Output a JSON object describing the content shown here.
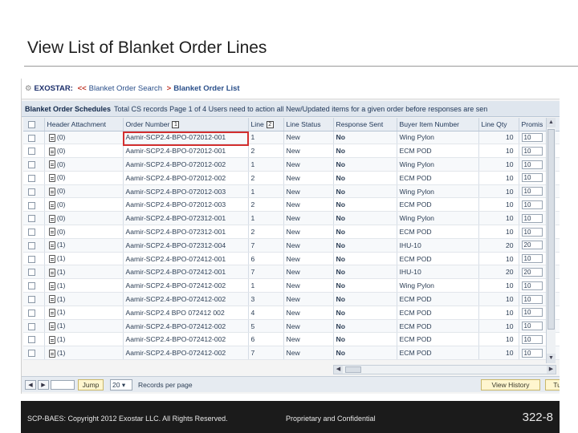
{
  "slide": {
    "title": "View List of Blanket Order Lines"
  },
  "breadcrumb": {
    "brand": "EXOSTAR:",
    "separator": "<<",
    "link": "Blanket Order Search",
    "arrow": ">",
    "current": "Blanket Order List"
  },
  "schedule_bar": {
    "heading": "Blanket Order Schedules",
    "info": "Total CS records Page 1 of 4 Users need to action all New/Updated items for a given order before responses are sen"
  },
  "table": {
    "columns": {
      "header_attachment": "Header Attachment",
      "order_number": "Order Number",
      "order_badge": "1",
      "line": "Line",
      "line_badge": "2",
      "line_status": "Line Status",
      "response_sent": "Response Sent",
      "buyer_item_number": "Buyer Item Number",
      "line_qty": "Line Qty",
      "promise": "Promis"
    },
    "rows": [
      {
        "attach": "(0)",
        "order": "Aamir-SCP2.4-BPO-072012-001",
        "line": "1",
        "status": "New",
        "sent": "No",
        "item": "Wing Pylon",
        "qty": "10",
        "promise": "10"
      },
      {
        "attach": "(0)",
        "order": "Aamir-SCP2.4-BPO-072012-001",
        "line": "2",
        "status": "New",
        "sent": "No",
        "item": "ECM POD",
        "qty": "10",
        "promise": "10"
      },
      {
        "attach": "(0)",
        "order": "Aamir-SCP2.4-BPO-072012-002",
        "line": "1",
        "status": "New",
        "sent": "No",
        "item": "Wing Pylon",
        "qty": "10",
        "promise": "10"
      },
      {
        "attach": "(0)",
        "order": "Aamir-SCP2.4-BPO-072012-002",
        "line": "2",
        "status": "New",
        "sent": "No",
        "item": "ECM POD",
        "qty": "10",
        "promise": "10"
      },
      {
        "attach": "(0)",
        "order": "Aamir-SCP2.4-BPO-072012-003",
        "line": "1",
        "status": "New",
        "sent": "No",
        "item": "Wing Pylon",
        "qty": "10",
        "promise": "10"
      },
      {
        "attach": "(0)",
        "order": "Aamir-SCP2.4-BPO-072012-003",
        "line": "2",
        "status": "New",
        "sent": "No",
        "item": "ECM POD",
        "qty": "10",
        "promise": "10"
      },
      {
        "attach": "(0)",
        "order": "Aamir-SCP2.4-BPO-072312-001",
        "line": "1",
        "status": "New",
        "sent": "No",
        "item": "Wing Pylon",
        "qty": "10",
        "promise": "10"
      },
      {
        "attach": "(0)",
        "order": "Aamir-SCP2.4-BPO-072312-001",
        "line": "2",
        "status": "New",
        "sent": "No",
        "item": "ECM POD",
        "qty": "10",
        "promise": "10"
      },
      {
        "attach": "(1)",
        "order": "Aamir-SCP2.4-BPO-072312-004",
        "line": "7",
        "status": "New",
        "sent": "No",
        "item": "IHU-10",
        "qty": "20",
        "promise": "20"
      },
      {
        "attach": "(1)",
        "order": "Aamir-SCP2.4-BPO-072412-001",
        "line": "6",
        "status": "New",
        "sent": "No",
        "item": "ECM POD",
        "qty": "10",
        "promise": "10"
      },
      {
        "attach": "(1)",
        "order": "Aamir-SCP2.4-BPO-072412-001",
        "line": "7",
        "status": "New",
        "sent": "No",
        "item": "IHU-10",
        "qty": "20",
        "promise": "20"
      },
      {
        "attach": "(1)",
        "order": "Aamir-SCP2.4-BPO-072412-002",
        "line": "1",
        "status": "New",
        "sent": "No",
        "item": "Wing Pylon",
        "qty": "10",
        "promise": "10"
      },
      {
        "attach": "(1)",
        "order": "Aamir-SCP2.4-BPO-072412-002",
        "line": "3",
        "status": "New",
        "sent": "No",
        "item": "ECM POD",
        "qty": "10",
        "promise": "10"
      },
      {
        "attach": "(1)",
        "order": "Aamir-SCP2.4 BPO 072412 002",
        "line": "4",
        "status": "New",
        "sent": "No",
        "item": "ECM POD",
        "qty": "10",
        "promise": "10"
      },
      {
        "attach": "(1)",
        "order": "Aamir-SCP2.4-BPO-072412-002",
        "line": "5",
        "status": "New",
        "sent": "No",
        "item": "ECM POD",
        "qty": "10",
        "promise": "10"
      },
      {
        "attach": "(1)",
        "order": "Aamir-SCP2.4-BPO-072412-002",
        "line": "6",
        "status": "New",
        "sent": "No",
        "item": "ECM POD",
        "qty": "10",
        "promise": "10"
      },
      {
        "attach": "(1)",
        "order": "Aamir-SCP2.4-BPO-072412-002",
        "line": "7",
        "status": "New",
        "sent": "No",
        "item": "ECM POD",
        "qty": "10",
        "promise": "10"
      }
    ]
  },
  "pager": {
    "jump_label": "Jump",
    "per_page_value": "20",
    "per_page_label": "Records per page",
    "view_history_label": "View History",
    "extra_button_label": "Tu"
  },
  "footer": {
    "copyright": "SCP-BAES: Copyright 2012 Exostar LLC. All Rights Reserved.",
    "confidential": "Proprietary and Confidential",
    "page_number": "322-8"
  },
  "colors": {
    "highlight_box": "#d32f2f",
    "response_no": "#cc1d1d",
    "link": "#3a6bb0",
    "footer_bg": "#1b1b1b"
  }
}
